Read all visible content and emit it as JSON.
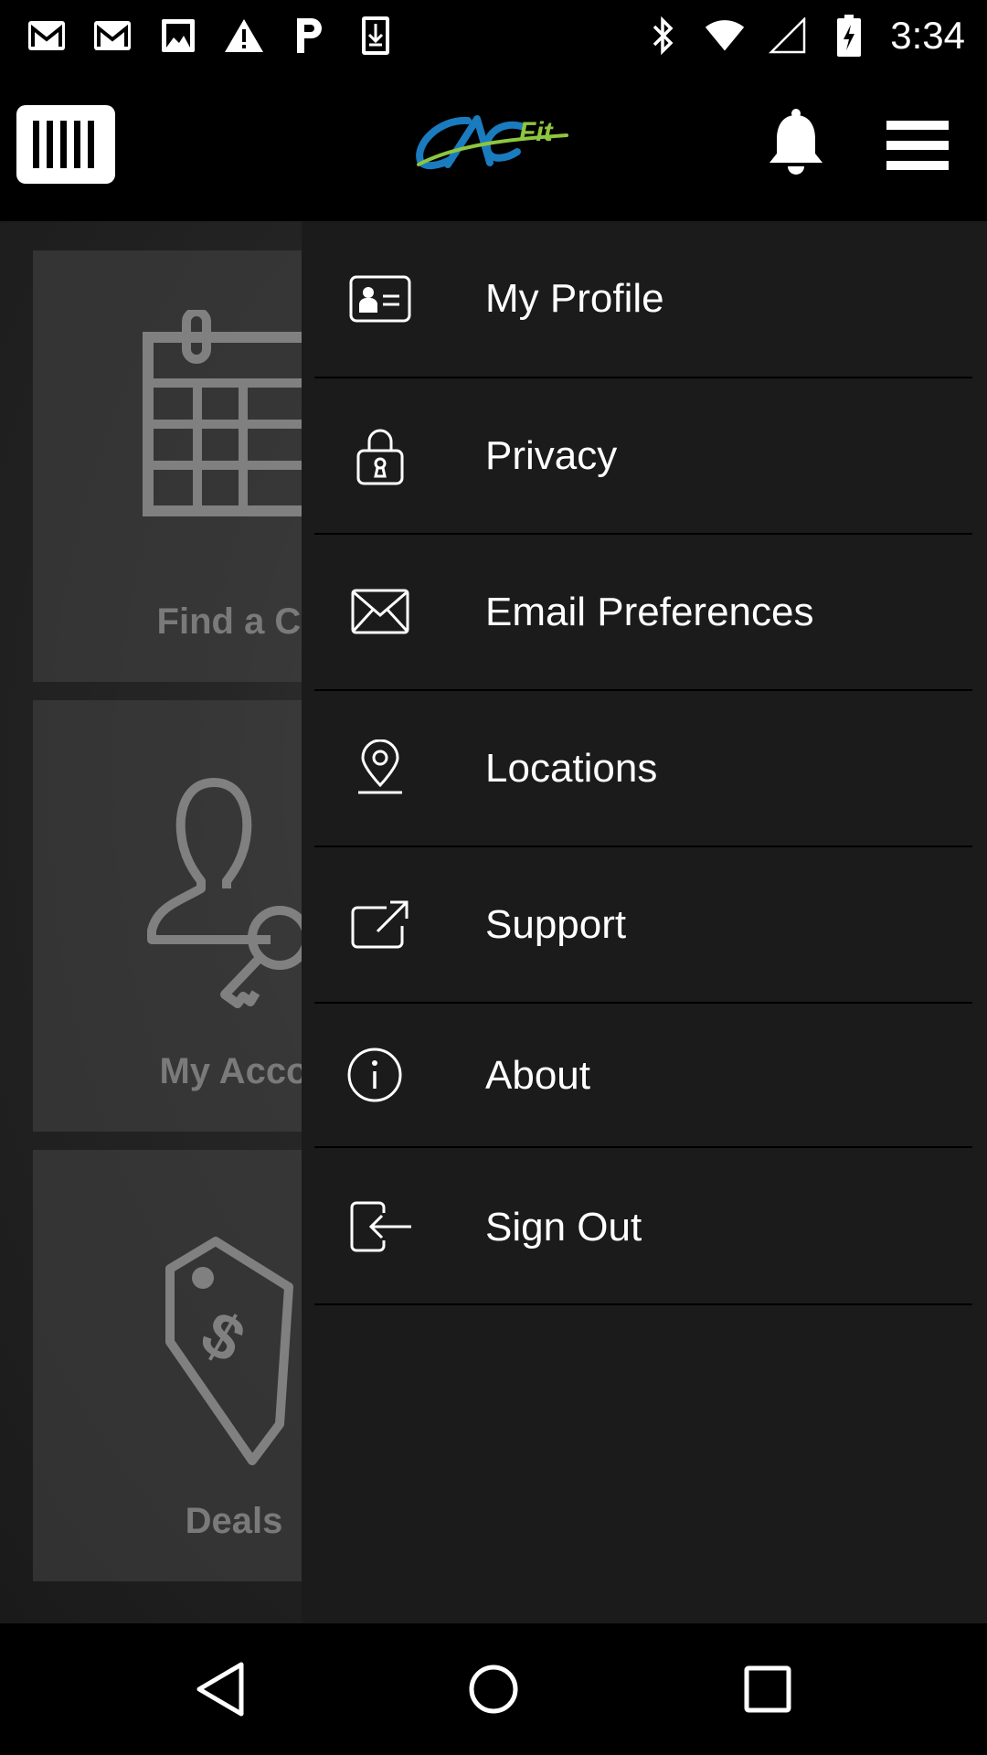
{
  "status_bar": {
    "time": "3:34",
    "left_icons": [
      "gmail-icon",
      "gmail-icon",
      "image-icon",
      "warning-icon",
      "parking-icon",
      "download-icon"
    ],
    "right_icons": [
      "bluetooth-icon",
      "wifi-icon",
      "cell-signal-icon",
      "battery-charging-icon"
    ]
  },
  "app_bar": {
    "logo_text": "CAC",
    "logo_sub": "Fit",
    "logo_colors": {
      "primary": "#1a7bbf",
      "accent": "#8dc63f"
    }
  },
  "background_tiles": [
    {
      "label": "Find a Cl",
      "icon": "calendar-icon"
    },
    {
      "label": "My Acco",
      "icon": "user-key-icon"
    },
    {
      "label": "Deals",
      "icon": "price-tag-icon"
    }
  ],
  "drawer": {
    "items": [
      {
        "label": "My Profile",
        "icon": "id-card-icon"
      },
      {
        "label": "Privacy",
        "icon": "lock-icon"
      },
      {
        "label": "Email Preferences",
        "icon": "envelope-icon"
      },
      {
        "label": "Locations",
        "icon": "map-pin-icon"
      },
      {
        "label": "Support",
        "icon": "external-link-icon"
      },
      {
        "label": "About",
        "icon": "info-icon"
      },
      {
        "label": "Sign Out",
        "icon": "sign-out-icon"
      }
    ]
  },
  "nav_bar": {
    "buttons": [
      "back-icon",
      "home-icon",
      "recents-icon"
    ]
  }
}
